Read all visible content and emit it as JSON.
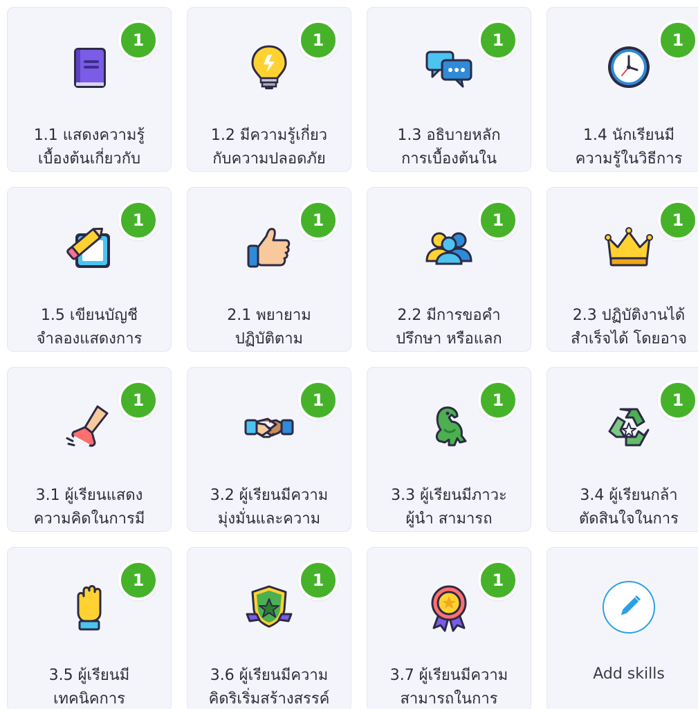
{
  "cards": [
    {
      "label": [
        "1.1 แสดงความรู้",
        "เบื้องต้นเกี่ยวกับ"
      ],
      "count": "1",
      "icon": "book-icon"
    },
    {
      "label": [
        "1.2 มีความรู้เกี่ยว",
        "กับความปลอดภัย"
      ],
      "count": "1",
      "icon": "lightbulb-icon"
    },
    {
      "label": [
        "1.3 อธิบายหลัก",
        "การเบื้องต้นใน"
      ],
      "count": "1",
      "icon": "chat-bubbles-icon"
    },
    {
      "label": [
        "1.4 นักเรียนมี",
        "ความรู้ในวิธีการ"
      ],
      "count": "1",
      "icon": "clock-icon"
    },
    {
      "label": [
        "1.5 เขียนบัญชี",
        "จำลองแสดงการ"
      ],
      "count": "1",
      "icon": "pencil-paper-icon"
    },
    {
      "label": [
        "2.1 พยายาม",
        "ปฏิบัติตาม"
      ],
      "count": "1",
      "icon": "thumbs-up-icon"
    },
    {
      "label": [
        "2.2 มีการขอคำ",
        "ปรึกษา หรือแลก"
      ],
      "count": "1",
      "icon": "people-icon"
    },
    {
      "label": [
        "2.3 ปฏิบัติงานได้",
        "สำเร็จได้ โดยอาจ"
      ],
      "count": "1",
      "icon": "crown-icon"
    },
    {
      "label": [
        "3.1 ผู้เรียนแสดง",
        "ความคิดในการมี"
      ],
      "count": "1",
      "icon": "leg-sneaker-icon"
    },
    {
      "label": [
        "3.2 ผู้เรียนมีความ",
        "มุ่งมั่นและความ"
      ],
      "count": "1",
      "icon": "handshake-icon"
    },
    {
      "label": [
        "3.3 ผู้เรียนมีภาวะ",
        "ผู้นำ สามารถ"
      ],
      "count": "1",
      "icon": "dinosaur-icon"
    },
    {
      "label": [
        "3.4 ผู้เรียนกล้า",
        "ตัดสินใจในการ"
      ],
      "count": "1",
      "icon": "recycle-icon"
    },
    {
      "label": [
        "3.5 ผู้เรียนมี",
        "เทคนิคการ"
      ],
      "count": "1",
      "icon": "raised-hand-icon"
    },
    {
      "label": [
        "3.6 ผู้เรียนมีความ",
        "คิดริเริ่มสร้างสรรค์"
      ],
      "count": "1",
      "icon": "shield-star-icon"
    },
    {
      "label": [
        "3.7 ผู้เรียนมีความ",
        "สามารถในการ"
      ],
      "count": "1",
      "icon": "award-medal-icon"
    }
  ],
  "add_skills": {
    "label": "Add skills",
    "icon": "pencil-icon"
  },
  "colors": {
    "badge": "#46b22a",
    "card_bg": "#f4f5fb",
    "card_border": "#e4e6f2",
    "accent": "#2ba0e6"
  }
}
